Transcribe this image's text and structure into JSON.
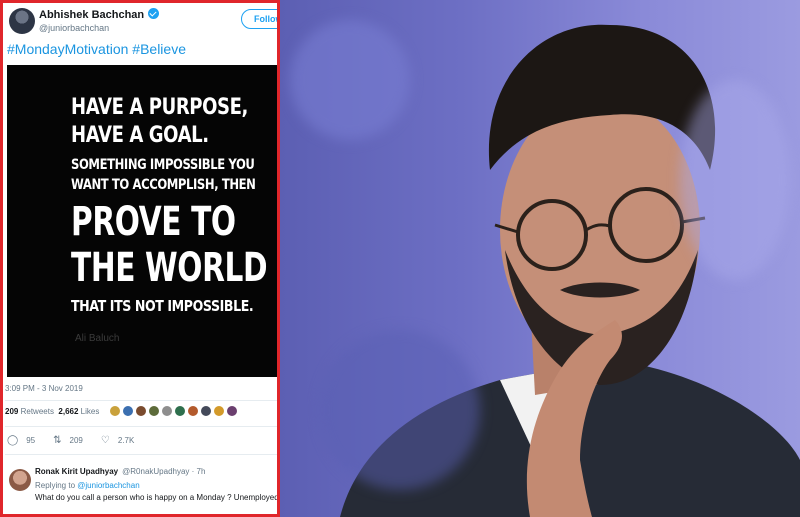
{
  "tweet": {
    "author_name": "Abhishek Bachchan",
    "author_handle": "@juniorbachchan",
    "follow_label": "Follow",
    "text": "#MondayMotivation #Believe",
    "image": {
      "line1": "HAVE A PURPOSE,",
      "line2": "HAVE A GOAL.",
      "line3": "SOMETHING IMPOSSIBLE YOU",
      "line4": "WANT TO ACCOMPLISH, THEN",
      "line5": "PROVE TO",
      "line6": "THE WORLD",
      "line7": "THAT ITS NOT IMPOSSIBLE.",
      "author": "Ali Baluch"
    },
    "timestamp": "3:09 PM - 3 Nov 2019",
    "stats": {
      "retweets_count": "209",
      "retweets_label": "Retweets",
      "likes_count": "2,662",
      "likes_label": "Likes"
    },
    "liker_colors": [
      "#c9a13b",
      "#3b6fb0",
      "#7a4b2e",
      "#5d6b3a",
      "#8e8e8e",
      "#2e6f4d",
      "#b35a2c",
      "#444a5a",
      "#d39a2a",
      "#6b3f6f"
    ],
    "actions": {
      "reply_count": "95",
      "retweet_count": "209",
      "like_count": "2.7K"
    }
  },
  "reply": {
    "name": "Ronak Kirit Upadhyay",
    "handle": "@R0nakUpadhyay · 7h",
    "replying_prefix": "Replying to",
    "replying_handle": "@juniorbachchan",
    "text": "What do you call a person who is happy on a Monday ? Unemployed"
  },
  "colors": {
    "border_red": "#e0262b",
    "twitter_blue": "#1da1f2",
    "link_blue": "#1b95e0",
    "photo_bg": "#6d6fc4"
  }
}
